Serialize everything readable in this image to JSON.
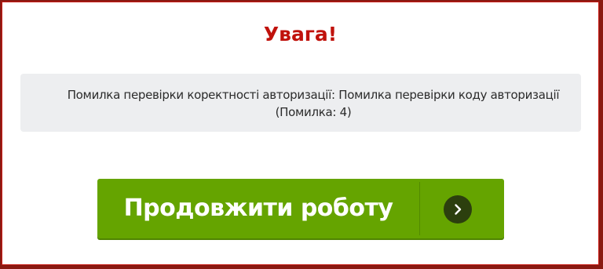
{
  "dialog": {
    "title": "Увага!",
    "message_line1": "Помилка перевірки коректності авторизації: Помилка перевірки коду авторизації",
    "message_line2": "(Помилка: 4)",
    "continue_label": "Продовжити роботу",
    "continue_icon": "chevron-right-icon"
  },
  "colors": {
    "title": "#c0120c",
    "button": "#65a400",
    "message_bg": "#edeef0"
  }
}
